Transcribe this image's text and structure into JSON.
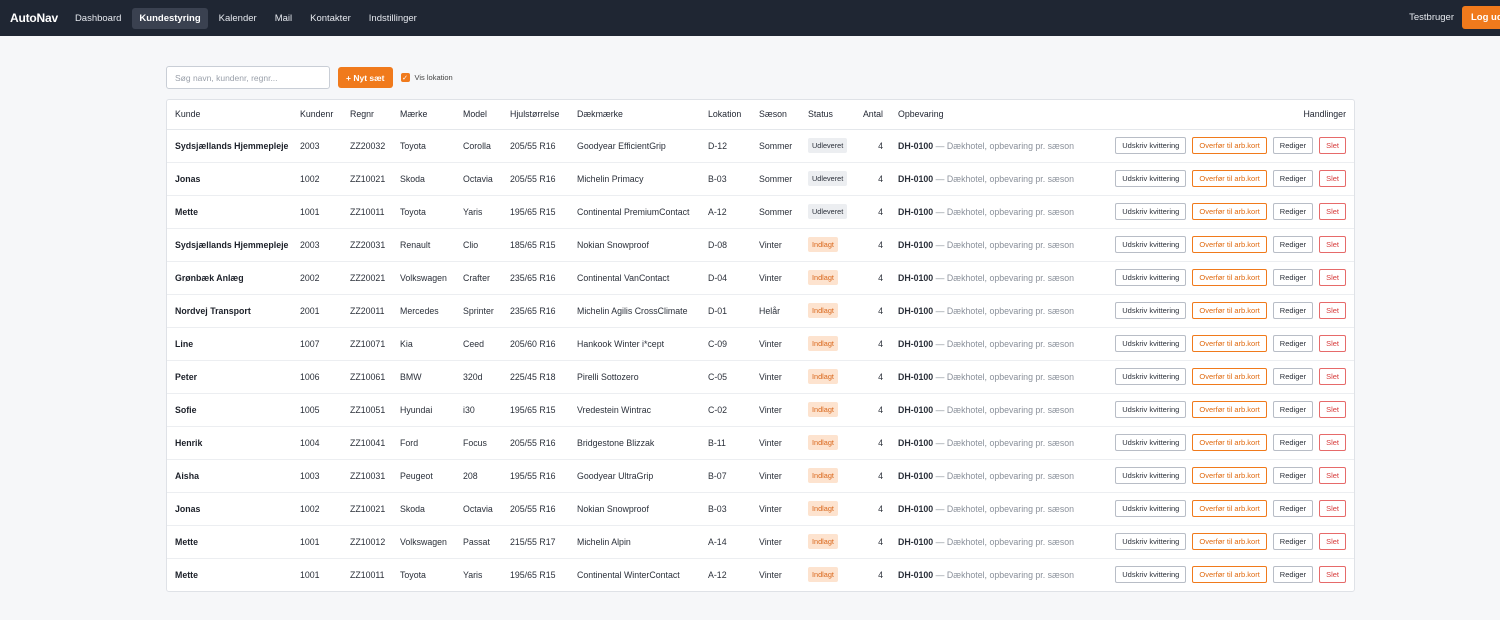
{
  "app": {
    "brand": "AutoNav"
  },
  "nav": [
    {
      "label": "Dashboard",
      "name": "nav-dashboard",
      "active": false
    },
    {
      "label": "Kundestyring",
      "name": "nav-kundestyring",
      "active": true
    },
    {
      "label": "Kalender",
      "name": "nav-kalender",
      "active": false
    },
    {
      "label": "Mail",
      "name": "nav-mail",
      "active": false
    },
    {
      "label": "Kontakter",
      "name": "nav-kontakter",
      "active": false
    },
    {
      "label": "Indstillinger",
      "name": "nav-indstillinger",
      "active": false
    }
  ],
  "user": {
    "name": "Testbruger",
    "logout_label": "Log ud"
  },
  "toolbar": {
    "search_placeholder": "Søg navn, kundenr, regnr...",
    "new_label": "+ Nyt sæt",
    "show_location_label": "Vis lokation",
    "show_location_checked": true
  },
  "table": {
    "headers": {
      "kunde": "Kunde",
      "kundenr": "Kundenr",
      "regnr": "Regnr",
      "maerke": "Mærke",
      "model": "Model",
      "hjul": "Hjulstørrelse",
      "daek": "Dækmærke",
      "lokation": "Lokation",
      "saeson": "Sæson",
      "status": "Status",
      "antal": "Antal",
      "opbevaring": "Opbevaring",
      "handlinger": "Handlinger"
    },
    "action_labels": {
      "print": "Udskriv kvittering",
      "transfer": "Overfør til arb.kort",
      "edit": "Rediger",
      "delete": "Slet"
    },
    "status_colors": {
      "Udleveret": "#eceef1",
      "Indlagt": "#fde3cf"
    },
    "rows": [
      {
        "kunde": "Sydsjællands Hjemmepleje",
        "kundenr": "2003",
        "regnr": "ZZ20032",
        "maerke": "Toyota",
        "model": "Corolla",
        "hjul": "205/55 R16",
        "daek": "Goodyear EfficientGrip",
        "lokation": "D-12",
        "saeson": "Sommer",
        "status": "Udleveret",
        "antal": "4",
        "opb_code": "DH-0100",
        "opb_desc": " — Dækhotel, opbevaring pr. sæson"
      },
      {
        "kunde": "Jonas",
        "kundenr": "1002",
        "regnr": "ZZ10021",
        "maerke": "Skoda",
        "model": "Octavia",
        "hjul": "205/55 R16",
        "daek": "Michelin Primacy",
        "lokation": "B-03",
        "saeson": "Sommer",
        "status": "Udleveret",
        "antal": "4",
        "opb_code": "DH-0100",
        "opb_desc": " — Dækhotel, opbevaring pr. sæson"
      },
      {
        "kunde": "Mette",
        "kundenr": "1001",
        "regnr": "ZZ10011",
        "maerke": "Toyota",
        "model": "Yaris",
        "hjul": "195/65 R15",
        "daek": "Continental PremiumContact",
        "lokation": "A-12",
        "saeson": "Sommer",
        "status": "Udleveret",
        "antal": "4",
        "opb_code": "DH-0100",
        "opb_desc": " — Dækhotel, opbevaring pr. sæson"
      },
      {
        "kunde": "Sydsjællands Hjemmepleje",
        "kundenr": "2003",
        "regnr": "ZZ20031",
        "maerke": "Renault",
        "model": "Clio",
        "hjul": "185/65 R15",
        "daek": "Nokian Snowproof",
        "lokation": "D-08",
        "saeson": "Vinter",
        "status": "Indlagt",
        "antal": "4",
        "opb_code": "DH-0100",
        "opb_desc": " — Dækhotel, opbevaring pr. sæson"
      },
      {
        "kunde": "Grønbæk Anlæg",
        "kundenr": "2002",
        "regnr": "ZZ20021",
        "maerke": "Volkswagen",
        "model": "Crafter",
        "hjul": "235/65 R16",
        "daek": "Continental VanContact",
        "lokation": "D-04",
        "saeson": "Vinter",
        "status": "Indlagt",
        "antal": "4",
        "opb_code": "DH-0100",
        "opb_desc": " — Dækhotel, opbevaring pr. sæson"
      },
      {
        "kunde": "Nordvej Transport",
        "kundenr": "2001",
        "regnr": "ZZ20011",
        "maerke": "Mercedes",
        "model": "Sprinter",
        "hjul": "235/65 R16",
        "daek": "Michelin Agilis CrossClimate",
        "lokation": "D-01",
        "saeson": "Helår",
        "status": "Indlagt",
        "antal": "4",
        "opb_code": "DH-0100",
        "opb_desc": " — Dækhotel, opbevaring pr. sæson"
      },
      {
        "kunde": "Line",
        "kundenr": "1007",
        "regnr": "ZZ10071",
        "maerke": "Kia",
        "model": "Ceed",
        "hjul": "205/60 R16",
        "daek": "Hankook Winter i*cept",
        "lokation": "C-09",
        "saeson": "Vinter",
        "status": "Indlagt",
        "antal": "4",
        "opb_code": "DH-0100",
        "opb_desc": " — Dækhotel, opbevaring pr. sæson"
      },
      {
        "kunde": "Peter",
        "kundenr": "1006",
        "regnr": "ZZ10061",
        "maerke": "BMW",
        "model": "320d",
        "hjul": "225/45 R18",
        "daek": "Pirelli Sottozero",
        "lokation": "C-05",
        "saeson": "Vinter",
        "status": "Indlagt",
        "antal": "4",
        "opb_code": "DH-0100",
        "opb_desc": " — Dækhotel, opbevaring pr. sæson"
      },
      {
        "kunde": "Sofie",
        "kundenr": "1005",
        "regnr": "ZZ10051",
        "maerke": "Hyundai",
        "model": "i30",
        "hjul": "195/65 R15",
        "daek": "Vredestein Wintrac",
        "lokation": "C-02",
        "saeson": "Vinter",
        "status": "Indlagt",
        "antal": "4",
        "opb_code": "DH-0100",
        "opb_desc": " — Dækhotel, opbevaring pr. sæson"
      },
      {
        "kunde": "Henrik",
        "kundenr": "1004",
        "regnr": "ZZ10041",
        "maerke": "Ford",
        "model": "Focus",
        "hjul": "205/55 R16",
        "daek": "Bridgestone Blizzak",
        "lokation": "B-11",
        "saeson": "Vinter",
        "status": "Indlagt",
        "antal": "4",
        "opb_code": "DH-0100",
        "opb_desc": " — Dækhotel, opbevaring pr. sæson"
      },
      {
        "kunde": "Aisha",
        "kundenr": "1003",
        "regnr": "ZZ10031",
        "maerke": "Peugeot",
        "model": "208",
        "hjul": "195/55 R16",
        "daek": "Goodyear UltraGrip",
        "lokation": "B-07",
        "saeson": "Vinter",
        "status": "Indlagt",
        "antal": "4",
        "opb_code": "DH-0100",
        "opb_desc": " — Dækhotel, opbevaring pr. sæson"
      },
      {
        "kunde": "Jonas",
        "kundenr": "1002",
        "regnr": "ZZ10021",
        "maerke": "Skoda",
        "model": "Octavia",
        "hjul": "205/55 R16",
        "daek": "Nokian Snowproof",
        "lokation": "B-03",
        "saeson": "Vinter",
        "status": "Indlagt",
        "antal": "4",
        "opb_code": "DH-0100",
        "opb_desc": " — Dækhotel, opbevaring pr. sæson"
      },
      {
        "kunde": "Mette",
        "kundenr": "1001",
        "regnr": "ZZ10012",
        "maerke": "Volkswagen",
        "model": "Passat",
        "hjul": "215/55 R17",
        "daek": "Michelin Alpin",
        "lokation": "A-14",
        "saeson": "Vinter",
        "status": "Indlagt",
        "antal": "4",
        "opb_code": "DH-0100",
        "opb_desc": " — Dækhotel, opbevaring pr. sæson"
      },
      {
        "kunde": "Mette",
        "kundenr": "1001",
        "regnr": "ZZ10011",
        "maerke": "Toyota",
        "model": "Yaris",
        "hjul": "195/65 R15",
        "daek": "Continental WinterContact",
        "lokation": "A-12",
        "saeson": "Vinter",
        "status": "Indlagt",
        "antal": "4",
        "opb_code": "DH-0100",
        "opb_desc": " — Dækhotel, opbevaring pr. sæson"
      }
    ]
  }
}
